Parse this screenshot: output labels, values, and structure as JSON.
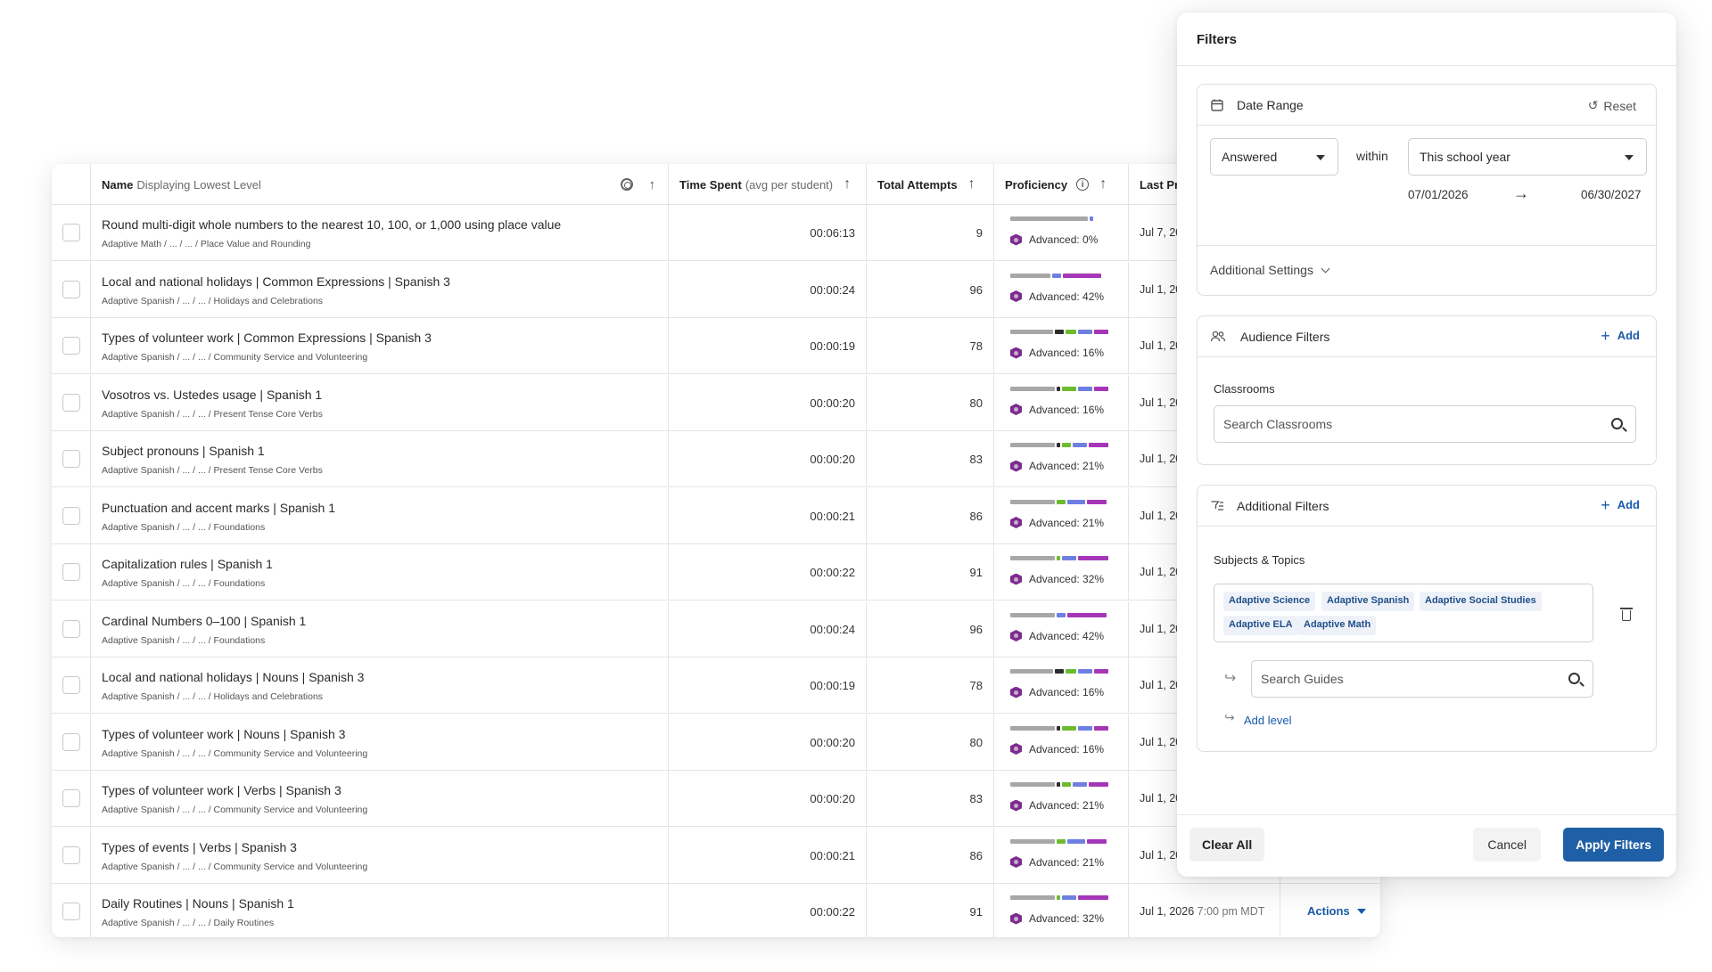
{
  "table": {
    "columns": {
      "name": "Name",
      "name_hint": "Displaying Lowest Level",
      "time": "Time Spent",
      "time_hint": "(avg per student)",
      "attempts": "Total Attempts",
      "proficiency": "Proficiency",
      "last": "Last Pra"
    },
    "rows": [
      {
        "name": "Round multi-digit whole numbers to the nearest 10, 100, or 1,000 using place value",
        "path": "Adaptive Math / ... / ... / Place Value and Rounding",
        "time": "00:06:13",
        "attempts": "9",
        "advanced": "Advanced: 0%",
        "last": "Jul 7, 20",
        "bar": [
          [
            "#a7a7a7",
            87
          ],
          [
            "#6f7fe0",
            4
          ]
        ]
      },
      {
        "name": "Local and national holidays | Common Expressions | Spanish 3",
        "path": "Adaptive Spanish / ... / ... / Holidays and Celebrations",
        "time": "00:00:24",
        "attempts": "96",
        "advanced": "Advanced: 42%",
        "last": "Jul 1, 20",
        "bar": [
          [
            "#a7a7a7",
            45
          ],
          [
            "#6f7fe0",
            10
          ],
          [
            "#a536b8",
            43
          ]
        ]
      },
      {
        "name": "Types of volunteer work | Common Expressions | Spanish 3",
        "path": "Adaptive Spanish / ... / ... / Community Service and Volunteering",
        "time": "00:00:19",
        "attempts": "78",
        "advanced": "Advanced: 16%",
        "last": "Jul 1, 20",
        "bar": [
          [
            "#a7a7a7",
            48
          ],
          [
            "#2c2c2c",
            10
          ],
          [
            "#6dbb2f",
            12
          ],
          [
            "#6f7fe0",
            16
          ],
          [
            "#a536b8",
            16
          ]
        ]
      },
      {
        "name": "Vosotros vs. Ustedes usage | Spanish 1",
        "path": "Adaptive Spanish / ... / ... / Present Tense Core Verbs",
        "time": "00:00:20",
        "attempts": "80",
        "advanced": "Advanced: 16%",
        "last": "Jul 1, 20",
        "bar": [
          [
            "#a7a7a7",
            50
          ],
          [
            "#2c2c2c",
            4
          ],
          [
            "#6dbb2f",
            16
          ],
          [
            "#6f7fe0",
            16
          ],
          [
            "#a536b8",
            16
          ]
        ]
      },
      {
        "name": "Subject pronouns | Spanish 1",
        "path": "Adaptive Spanish / ... / ... / Present Tense Core Verbs",
        "time": "00:00:20",
        "attempts": "83",
        "advanced": "Advanced: 21%",
        "last": "Jul 1, 20",
        "bar": [
          [
            "#a7a7a7",
            50
          ],
          [
            "#2c2c2c",
            4
          ],
          [
            "#6dbb2f",
            10
          ],
          [
            "#6f7fe0",
            16
          ],
          [
            "#a536b8",
            22
          ]
        ]
      },
      {
        "name": "Punctuation and accent marks | Spanish 1",
        "path": "Adaptive Spanish / ... / ... / Foundations",
        "time": "00:00:21",
        "attempts": "86",
        "advanced": "Advanced: 21%",
        "last": "Jul 1, 20",
        "bar": [
          [
            "#a7a7a7",
            50
          ],
          [
            "#6dbb2f",
            10
          ],
          [
            "#6f7fe0",
            20
          ],
          [
            "#a536b8",
            22
          ]
        ]
      },
      {
        "name": "Capitalization rules | Spanish 1",
        "path": "Adaptive Spanish / ... / ... / Foundations",
        "time": "00:00:22",
        "attempts": "91",
        "advanced": "Advanced: 32%",
        "last": "Jul 1, 20",
        "bar": [
          [
            "#a7a7a7",
            50
          ],
          [
            "#6dbb2f",
            4
          ],
          [
            "#6f7fe0",
            16
          ],
          [
            "#a536b8",
            34
          ]
        ]
      },
      {
        "name": "Cardinal Numbers 0–100 | Spanish 1",
        "path": "Adaptive Spanish / ... / ... / Foundations",
        "time": "00:00:24",
        "attempts": "96",
        "advanced": "Advanced: 42%",
        "last": "Jul 1, 20",
        "bar": [
          [
            "#a7a7a7",
            50
          ],
          [
            "#6f7fe0",
            10
          ],
          [
            "#a536b8",
            44
          ]
        ]
      },
      {
        "name": "Local and national holidays | Nouns | Spanish 3",
        "path": "Adaptive Spanish / ... / ... / Holidays and Celebrations",
        "time": "00:00:19",
        "attempts": "78",
        "advanced": "Advanced: 16%",
        "last": "Jul 1, 20",
        "bar": [
          [
            "#a7a7a7",
            48
          ],
          [
            "#2c2c2c",
            10
          ],
          [
            "#6dbb2f",
            12
          ],
          [
            "#6f7fe0",
            16
          ],
          [
            "#a536b8",
            16
          ]
        ]
      },
      {
        "name": "Types of volunteer work | Nouns | Spanish 3",
        "path": "Adaptive Spanish / ... / ... / Community Service and Volunteering",
        "time": "00:00:20",
        "attempts": "80",
        "advanced": "Advanced: 16%",
        "last": "Jul 1, 20",
        "bar": [
          [
            "#a7a7a7",
            50
          ],
          [
            "#2c2c2c",
            4
          ],
          [
            "#6dbb2f",
            16
          ],
          [
            "#6f7fe0",
            16
          ],
          [
            "#a536b8",
            16
          ]
        ]
      },
      {
        "name": "Types of volunteer work | Verbs | Spanish 3",
        "path": "Adaptive Spanish / ... / ... / Community Service and Volunteering",
        "time": "00:00:20",
        "attempts": "83",
        "advanced": "Advanced: 21%",
        "last": "Jul 1, 20",
        "bar": [
          [
            "#a7a7a7",
            50
          ],
          [
            "#2c2c2c",
            4
          ],
          [
            "#6dbb2f",
            10
          ],
          [
            "#6f7fe0",
            16
          ],
          [
            "#a536b8",
            22
          ]
        ]
      },
      {
        "name": "Types of events | Verbs | Spanish 3",
        "path": "Adaptive Spanish / ... / ... / Community Service and Volunteering",
        "time": "00:00:21",
        "attempts": "86",
        "advanced": "Advanced: 21%",
        "last": "Jul 1, 20",
        "bar": [
          [
            "#a7a7a7",
            50
          ],
          [
            "#6dbb2f",
            10
          ],
          [
            "#6f7fe0",
            20
          ],
          [
            "#a536b8",
            22
          ]
        ]
      },
      {
        "name": "Daily Routines | Nouns | Spanish 1",
        "path": "Adaptive Spanish / ... / ... / Daily Routines",
        "time": "00:00:22",
        "attempts": "91",
        "advanced": "Advanced: 32%",
        "last": "Jul 1, 2026",
        "last_time": "7:00 pm MDT",
        "bar": [
          [
            "#a7a7a7",
            50
          ],
          [
            "#6dbb2f",
            4
          ],
          [
            "#6f7fe0",
            16
          ],
          [
            "#a536b8",
            34
          ]
        ],
        "actions": "Actions"
      }
    ]
  },
  "filters": {
    "title": "Filters",
    "date_range": {
      "title": "Date Range",
      "reset": "Reset",
      "answered": "Answered",
      "within": "within",
      "period": "This school year",
      "start": "07/01/2026",
      "end": "06/30/2027",
      "additional_settings": "Additional Settings"
    },
    "audience": {
      "title": "Audience Filters",
      "add": "Add",
      "classrooms_label": "Classrooms",
      "search_placeholder": "Search Classrooms"
    },
    "additional": {
      "title": "Additional Filters",
      "add": "Add",
      "subjects_label": "Subjects & Topics",
      "chips": [
        "Adaptive Science",
        "Adaptive Spanish",
        "Adaptive Social Studies",
        "Adaptive ELA",
        "Adaptive Math"
      ],
      "guides_placeholder": "Search Guides",
      "add_level": "Add level"
    },
    "footer": {
      "clear": "Clear All",
      "cancel": "Cancel",
      "apply": "Apply Filters"
    }
  },
  "colors": {
    "accent": "#1f5fa6",
    "advanced_hex": "#7b2d8e"
  }
}
